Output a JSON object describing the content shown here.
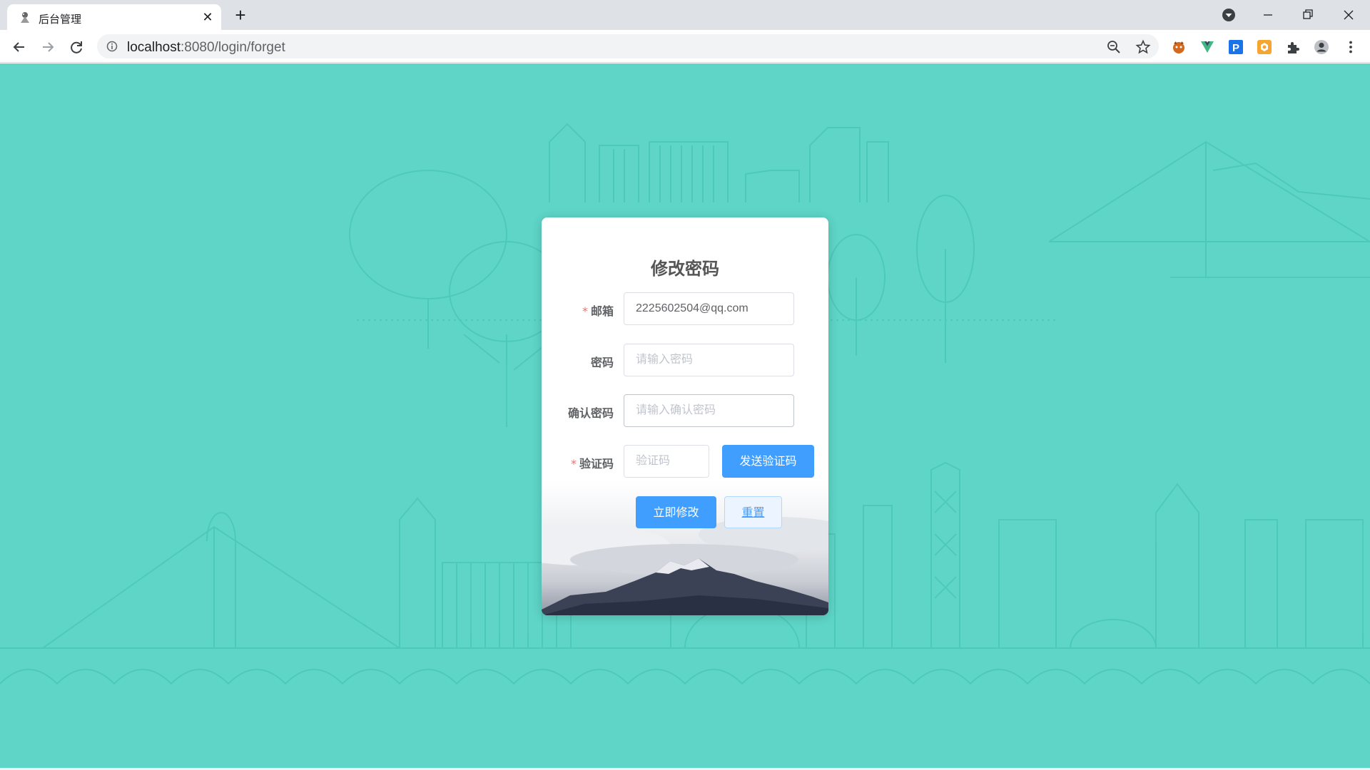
{
  "browser": {
    "tab_title": "后台管理",
    "tab_close": "✕",
    "new_tab": "+",
    "url_host": "localhost",
    "url_rest": ":8080/login/forget",
    "icons": [
      "favicon-icon",
      "close-icon",
      "plus-icon",
      "profile-dropdown-icon",
      "minimize-icon",
      "restore-icon",
      "window-close-icon",
      "back-icon",
      "forward-icon",
      "reload-icon",
      "info-icon",
      "zoom-icon",
      "star-icon",
      "extension-fox-icon",
      "extension-vue-icon",
      "extension-p-icon",
      "extension-orange-icon",
      "extensions-puzzle-icon",
      "profile-avatar-icon",
      "menu-kebab-icon"
    ]
  },
  "form": {
    "title": "修改密码",
    "email": {
      "label": "邮箱",
      "required": "*",
      "value": "2225602504@qq.com"
    },
    "password": {
      "label": "密码",
      "placeholder": "请输入密码"
    },
    "confirm": {
      "label": "确认密码",
      "placeholder": "请输入确认密码"
    },
    "code": {
      "label": "验证码",
      "required": "*",
      "placeholder": "验证码"
    },
    "send_code_button": "发送验证码",
    "submit_button": "立即修改",
    "reset_button": "重置"
  },
  "colors": {
    "page_bg": "#5ed5c7",
    "primary": "#409eff",
    "required": "#f56c6c"
  }
}
